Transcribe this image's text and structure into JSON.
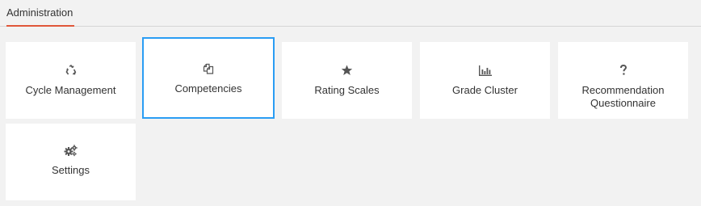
{
  "tabs": [
    {
      "label": "Administration",
      "active": true
    }
  ],
  "accent_color": "#e0573a",
  "selection_color": "#2a9df4",
  "tiles": [
    {
      "label": "Cycle Management",
      "icon": "recycle-icon"
    },
    {
      "label": "Competencies",
      "icon": "copy-icon",
      "selected": true
    },
    {
      "label": "Rating Scales",
      "icon": "star-icon"
    },
    {
      "label": "Grade Cluster",
      "icon": "bar-chart-icon"
    },
    {
      "label_line1": "Recommendation",
      "label_line2": "Questionnaire",
      "icon": "question-icon"
    },
    {
      "label": "Settings",
      "icon": "gears-icon"
    }
  ]
}
